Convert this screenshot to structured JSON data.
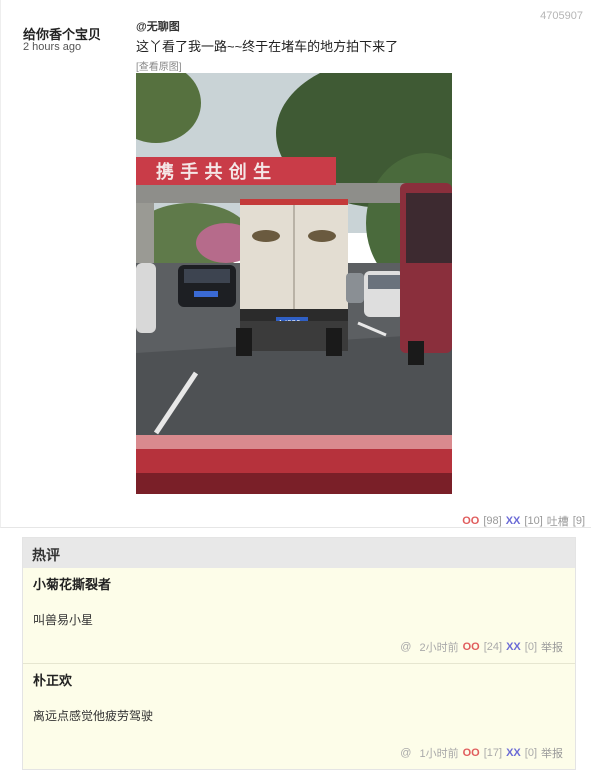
{
  "post": {
    "id": "4705907",
    "author": "给你香个宝贝",
    "time": "2 hours ago",
    "source": "@无聊图",
    "caption": "这丫看了我一路~~终于在堵车的地方拍下来了",
    "view_original": "[查看原图]",
    "photo_banner_text": "携 手 共 创 生",
    "photo_plate_text": "A·J086",
    "footer": {
      "oo_label": "OO",
      "oo_count": "[98]",
      "xx_label": "XX",
      "xx_count": "[10]",
      "tucao_label": "吐槽",
      "tucao_count": "[9]"
    }
  },
  "hot": {
    "title": "热评",
    "comments": [
      {
        "author": "小菊花撕裂者",
        "text": "叫兽易小星",
        "at": "@",
        "time": "2小时前",
        "oo_label": "OO",
        "oo_count": "[24]",
        "xx_label": "XX",
        "xx_count": "[0]",
        "report": "举报"
      },
      {
        "author": "朴正欢",
        "text": "离远点感觉他疲劳驾驶",
        "at": "@",
        "time": "1小时前",
        "oo_label": "OO",
        "oo_count": "[17]",
        "xx_label": "XX",
        "xx_count": "[0]",
        "report": "举报"
      }
    ]
  },
  "colors": {
    "oo": "#e05c5c",
    "xx": "#6b6bd6",
    "hot_bg": "#fdfde9",
    "hot_header_bg": "#e8e8e8"
  }
}
